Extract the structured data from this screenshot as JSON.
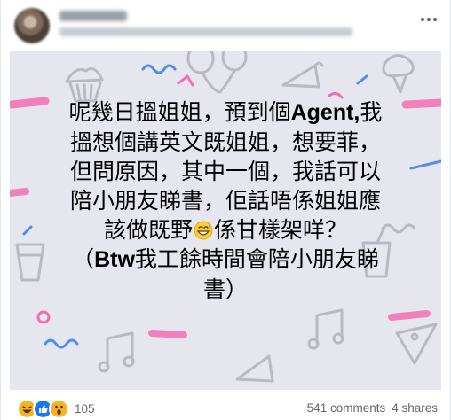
{
  "post": {
    "lines": [
      {
        "t1": "呢幾日搵姐姐，預到個",
        "b": "Agent,",
        "t2": "我"
      },
      {
        "t1": "搵想個講英文既姐姐，想要菲，"
      },
      {
        "t1": "但問原因，其中一個，我話可以"
      },
      {
        "t1": "陪小朋友睇書，佢話唔係姐姐應"
      },
      {
        "t1": "該做既野",
        "emoji": "grinning-sweat-emoji",
        "t2": "係甘樣架咩？"
      },
      {
        "t1": "（",
        "b": "Btw",
        "t2": "我工餘時間會陪小朋友睇"
      },
      {
        "t1": "書）"
      }
    ],
    "background_color": "#e6e6ef"
  },
  "footer": {
    "reaction_count": "105",
    "reactions": [
      "laugh-reaction-icon",
      "like-reaction-icon",
      "wow-reaction-icon"
    ],
    "comments": "541 comments",
    "shares": "4 shares"
  },
  "colors": {
    "doodle_pink": "#f36fb0",
    "doodle_blue": "#4f8df0",
    "doodle_grey": "#b9b9c4",
    "text_secondary": "#65676b"
  }
}
